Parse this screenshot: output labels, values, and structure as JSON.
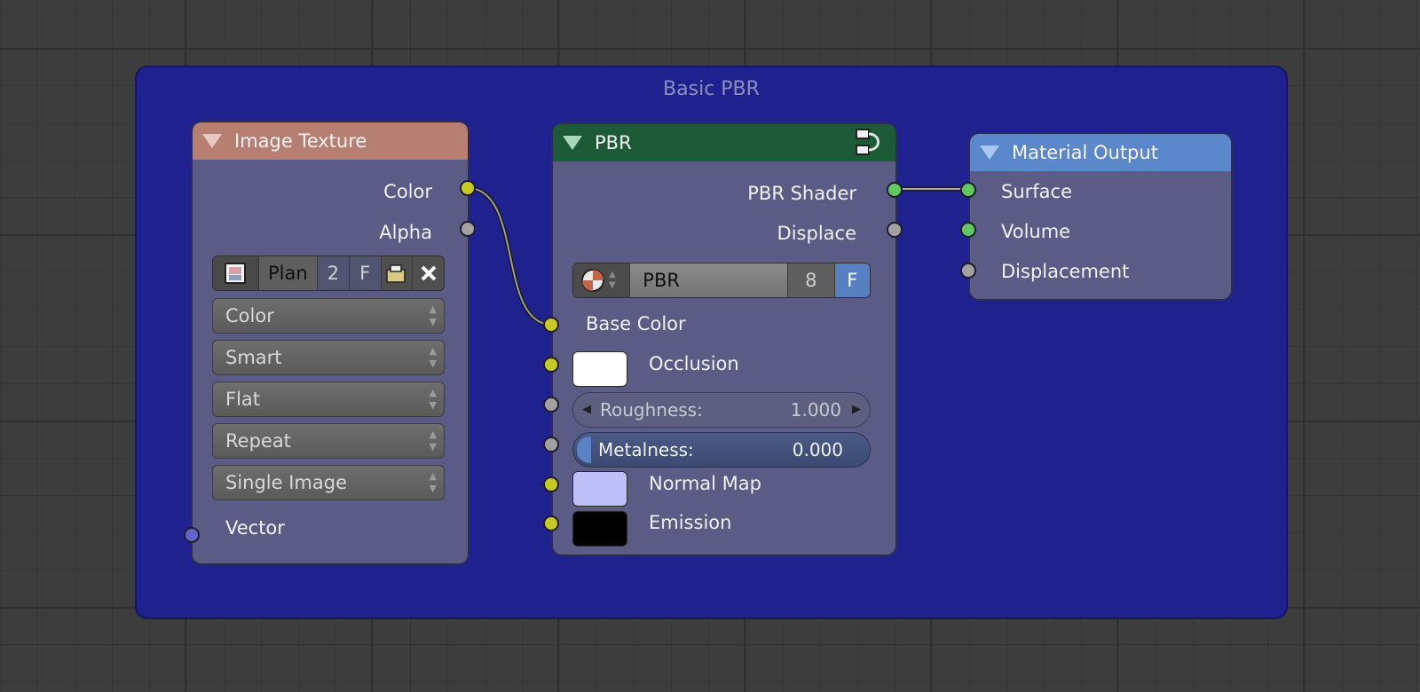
{
  "frame": {
    "title": "Basic PBR"
  },
  "image_texture": {
    "title": "Image Texture",
    "outputs": {
      "color": "Color",
      "alpha": "Alpha"
    },
    "image": {
      "name": "Plan",
      "users": "2",
      "fake_user": "F"
    },
    "dropdowns": [
      "Color",
      "Smart",
      "Flat",
      "Repeat",
      "Single Image"
    ],
    "inputs": {
      "vector": "Vector"
    }
  },
  "pbr": {
    "title": "PBR",
    "outputs": {
      "shader": "PBR Shader",
      "displace": "Displace"
    },
    "group": {
      "name": "PBR",
      "users": "8",
      "fake_user": "F"
    },
    "inputs": {
      "base_color": "Base Color",
      "occlusion": "Occlusion",
      "roughness_label": "Roughness:",
      "roughness_value": "1.000",
      "metalness_label": "Metalness:",
      "metalness_value": "0.000",
      "normal_map": "Normal Map",
      "emission": "Emission"
    }
  },
  "material_output": {
    "title": "Material Output",
    "inputs": {
      "surface": "Surface",
      "volume": "Volume",
      "displacement": "Displacement"
    }
  },
  "colors": {
    "frame": "#1f218f",
    "image_header": "#b77e72",
    "pbr_header": "#1d5b38",
    "output_header": "#5b87cb",
    "occlusion_swatch": "#ffffff",
    "normal_swatch": "#bfbffa",
    "emission_swatch": "#000000"
  }
}
